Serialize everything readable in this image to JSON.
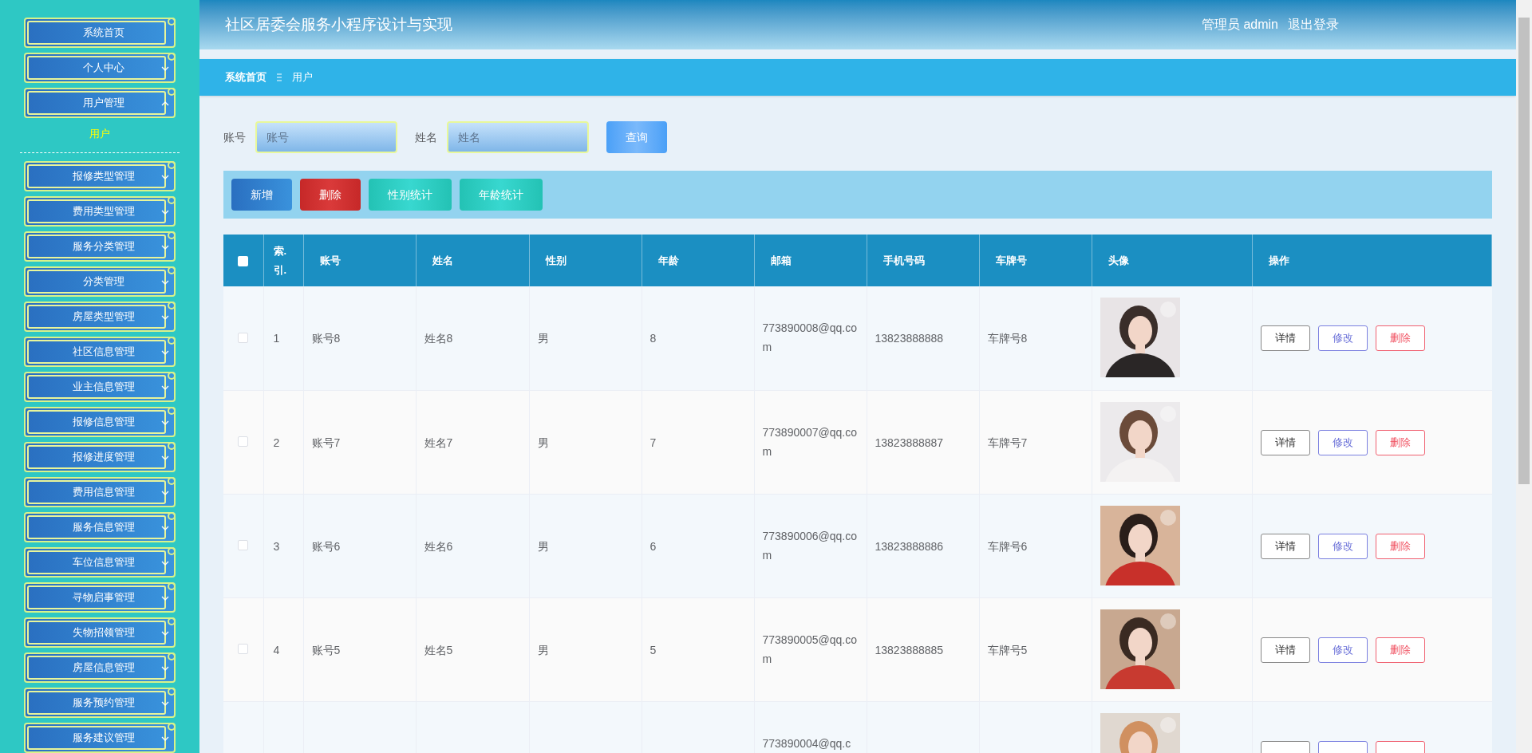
{
  "sidebar": {
    "items": [
      {
        "label": "系统首页"
      },
      {
        "label": "个人中心",
        "expanded": false
      },
      {
        "label": "用户管理",
        "expanded": true,
        "children": [
          {
            "label": "用户",
            "selected": true
          }
        ]
      },
      {
        "label": "报修类型管理",
        "expanded": false
      },
      {
        "label": "费用类型管理",
        "expanded": false
      },
      {
        "label": "服务分类管理",
        "expanded": false
      },
      {
        "label": "分类管理",
        "expanded": false
      },
      {
        "label": "房屋类型管理",
        "expanded": false
      },
      {
        "label": "社区信息管理",
        "expanded": false
      },
      {
        "label": "业主信息管理",
        "expanded": false
      },
      {
        "label": "报修信息管理",
        "expanded": false
      },
      {
        "label": "报修进度管理",
        "expanded": false
      },
      {
        "label": "费用信息管理",
        "expanded": false
      },
      {
        "label": "服务信息管理",
        "expanded": false
      },
      {
        "label": "车位信息管理",
        "expanded": false
      },
      {
        "label": "寻物启事管理",
        "expanded": false
      },
      {
        "label": "失物招领管理",
        "expanded": false
      },
      {
        "label": "房屋信息管理",
        "expanded": false
      },
      {
        "label": "服务预约管理",
        "expanded": false
      },
      {
        "label": "服务建议管理",
        "expanded": false
      }
    ]
  },
  "header": {
    "title": "社区居委会服务小程序设计与实现",
    "user": "管理员 admin",
    "logout": "退出登录"
  },
  "breadcrumb": [
    "系统首页",
    "用户"
  ],
  "search": {
    "fields": [
      {
        "label": "账号",
        "placeholder": "账号"
      },
      {
        "label": "姓名",
        "placeholder": "姓名"
      }
    ],
    "button": "查询"
  },
  "actions": [
    {
      "label": "新增",
      "kind": "primary"
    },
    {
      "label": "删除",
      "kind": "danger"
    },
    {
      "label": "性别统计",
      "kind": "teal"
    },
    {
      "label": "年龄统计",
      "kind": "teal"
    }
  ],
  "table": {
    "all_checked": false,
    "columns": [
      "索.引.",
      "账号",
      "姓名",
      "性别",
      "年龄",
      "邮箱",
      "手机号码",
      "车牌号",
      "头像",
      "操作"
    ],
    "rows": [
      {
        "checked": false,
        "index": "1",
        "account": "账号8",
        "name": "姓名8",
        "gender": "男",
        "age": "8",
        "email": "773890008@qq.com",
        "phone": "13823888888",
        "plate": "车牌号8",
        "avatar": {
          "kind": "picture"
        },
        "buttons": [
          {
            "label": "详情",
            "kind": "default"
          },
          {
            "label": "修改",
            "kind": "edit"
          },
          {
            "label": "删除",
            "kind": "delete"
          }
        ]
      },
      {
        "checked": false,
        "index": "2",
        "account": "账号7",
        "name": "姓名7",
        "gender": "男",
        "age": "7",
        "email": "773890007@qq.com",
        "phone": "13823888887",
        "plate": "车牌号7",
        "avatar": {
          "kind": "picture"
        },
        "buttons": [
          {
            "label": "详情",
            "kind": "default"
          },
          {
            "label": "修改",
            "kind": "edit"
          },
          {
            "label": "删除",
            "kind": "delete"
          }
        ]
      },
      {
        "checked": false,
        "index": "3",
        "account": "账号6",
        "name": "姓名6",
        "gender": "男",
        "age": "6",
        "email": "773890006@qq.com",
        "phone": "13823888886",
        "plate": "车牌号6",
        "avatar": {
          "kind": "picture"
        },
        "buttons": [
          {
            "label": "详情",
            "kind": "default"
          },
          {
            "label": "修改",
            "kind": "edit"
          },
          {
            "label": "删除",
            "kind": "delete"
          }
        ]
      },
      {
        "checked": false,
        "index": "4",
        "account": "账号5",
        "name": "姓名5",
        "gender": "男",
        "age": "5",
        "email": "773890005@qq.com",
        "phone": "13823888885",
        "plate": "车牌号5",
        "avatar": {
          "kind": "picture"
        },
        "buttons": [
          {
            "label": "详情",
            "kind": "default"
          },
          {
            "label": "修改",
            "kind": "edit"
          },
          {
            "label": "删除",
            "kind": "delete"
          }
        ]
      },
      {
        "email": "773890004@qq.c",
        "avatar": {
          "kind": "picture"
        },
        "buttons": [
          {
            "kind": "default"
          },
          {
            "kind": "edit"
          },
          {
            "kind": "delete"
          }
        ]
      }
    ]
  }
}
